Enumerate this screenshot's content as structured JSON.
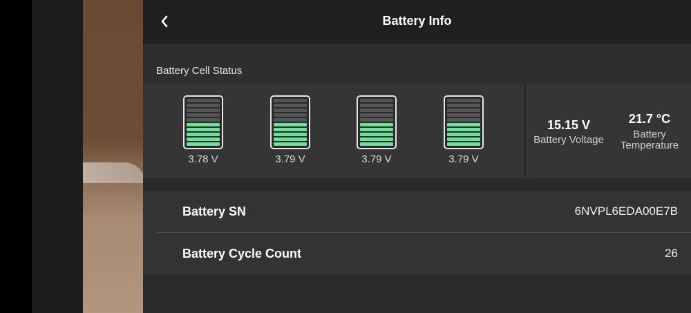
{
  "header": {
    "title": "Battery Info"
  },
  "cell_status": {
    "label": "Battery Cell Status",
    "cells": [
      {
        "voltage": "3.78 V",
        "level": 0.5
      },
      {
        "voltage": "3.79 V",
        "level": 0.5
      },
      {
        "voltage": "3.79 V",
        "level": 0.5
      },
      {
        "voltage": "3.79 V",
        "level": 0.5
      }
    ],
    "voltage": {
      "value": "15.15 V",
      "label": "Battery Voltage"
    },
    "temperature": {
      "value": "21.7 °C",
      "label_line1": "Battery",
      "label_line2": "Temperature"
    }
  },
  "rows": [
    {
      "label": "Battery SN",
      "value": "6NVPL6EDA00E7B"
    },
    {
      "label": "Battery Cycle Count",
      "value": "26"
    }
  ],
  "colors": {
    "cell_on": "#6ee09a",
    "cell_off": "#555555"
  },
  "icons": {
    "back": "chevron-left-icon"
  }
}
